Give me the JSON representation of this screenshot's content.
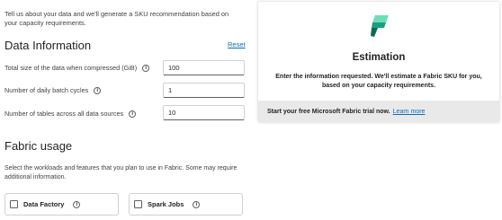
{
  "intro": "Tell us about your data and we'll generate a SKU recommendation based on your capacity requirements.",
  "data_information": {
    "title": "Data Information",
    "reset_label": "Reset",
    "fields": [
      {
        "label": "Total size of the data when compressed (GiB)",
        "value": "100",
        "icon": "info-icon"
      },
      {
        "label": "Number of daily batch cycles",
        "value": "1",
        "icon": "info-icon"
      },
      {
        "label": "Number of tables across all data sources",
        "value": "10",
        "icon": "info-icon"
      }
    ]
  },
  "fabric_usage": {
    "title": "Fabric usage",
    "description": "Select the workloads and features that you plan to use in Fabric. Some may require additional information.",
    "workloads": [
      {
        "label": "Data Factory",
        "checked": false,
        "icon": "info-icon"
      },
      {
        "label": "Spark Jobs",
        "checked": false,
        "icon": "info-icon"
      }
    ]
  },
  "estimation": {
    "logo": "microsoft-fabric-logo",
    "title": "Estimation",
    "description": "Enter the information requested. We'll estimate a Fabric SKU for you, based on your capacity requirements.",
    "footer_text": "Start your free Microsoft Fabric trial now.",
    "footer_link": "Learn more"
  },
  "colors": {
    "link": "#0f6cbd",
    "footer_bg": "#e9e9e9",
    "logo_dark": "#0b6a55",
    "logo_mid": "#1aa07d",
    "logo_light": "#6fdcb8"
  }
}
